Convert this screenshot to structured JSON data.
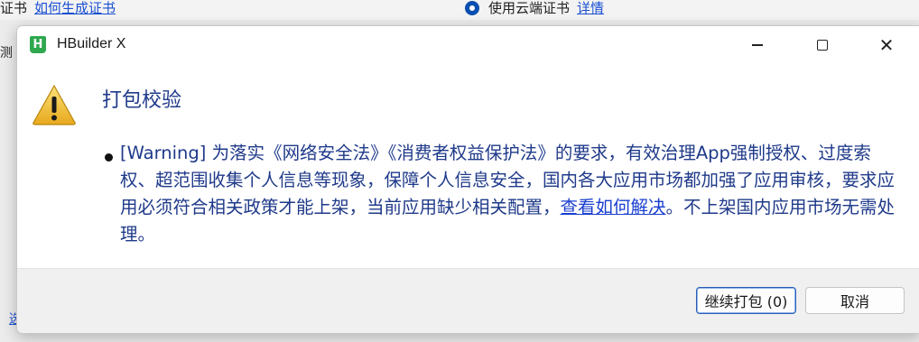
{
  "background": {
    "left_label": "证书",
    "left_link": "如何生成证书",
    "radio_label": "使用云端证书",
    "radio_link": "详情",
    "side_text": "测",
    "side_link": "选"
  },
  "dialog": {
    "app_icon_letter": "H",
    "title": "HBuilder X",
    "heading": "打包校验",
    "message_before_link": "[Warning] 为落实《网络安全法》《消费者权益保护法》的要求，有效治理App强制授权、过度索权、超范围收集个人信息等现象，保障个人信息安全，国内各大应用市场都加强了应用审核，要求应用必须符合相关政策才能上架，当前应用缺少相关配置，",
    "message_link": "查看如何解决",
    "message_after_link": "。不上架国内应用市场无需处理。",
    "buttons": {
      "continue_label": "继续打包 (0)",
      "cancel_label": "取消"
    }
  },
  "icons": {
    "app": "hbuilder-app-icon",
    "warning": "warning-triangle-icon",
    "minimize": "minimize-icon",
    "maximize": "maximize-icon",
    "close": "close-icon",
    "radio": "radio-selected-icon"
  },
  "colors": {
    "text_blue": "#1f3a8a",
    "link_blue": "#1a3fd0",
    "app_green": "#2fa84f",
    "warning_yellow": "#f2c230"
  }
}
